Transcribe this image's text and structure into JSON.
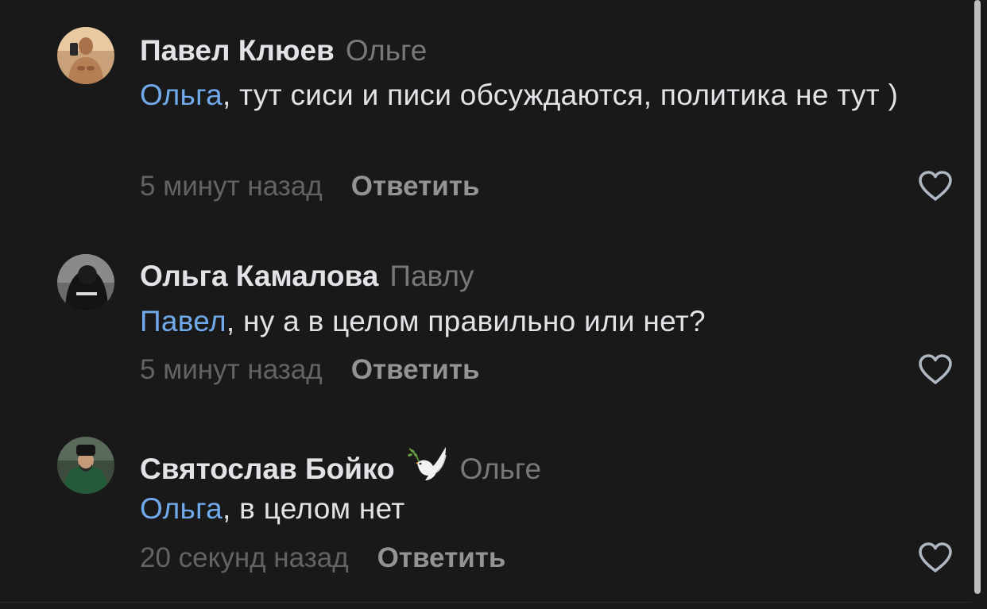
{
  "comments": [
    {
      "author": "Павел Клюев",
      "reply_to": "Ольге",
      "mention": "Ольга",
      "text": ", тут сиси и писи обсуждаются, политика не тут )",
      "time": "5 минут назад",
      "reply_label": "Ответить",
      "avatar": "shirtless-man-photo",
      "like_icon": "heart-outline"
    },
    {
      "author": "Ольга Камалова",
      "reply_to": "Павлу",
      "mention": "Павел",
      "text": ", ну а в целом правильно или нет?",
      "time": "5 минут назад",
      "reply_label": "Ответить",
      "avatar": "person-in-black-hoodie-photo",
      "like_icon": "heart-outline"
    },
    {
      "author": "Святослав Бойко",
      "author_emoji": "dove-with-olive-branch",
      "reply_to": "Ольге",
      "mention": "Ольга",
      "text": ", в целом нет",
      "time": "20 секунд назад",
      "reply_label": "Ответить",
      "avatar": "man-in-papakha-photo",
      "like_icon": "heart-outline"
    }
  ],
  "colors": {
    "background": "#19191a",
    "author": "#e1e3e6",
    "secondary": "#76787a",
    "mention": "#71aaeb",
    "reply_button": "#939393",
    "icon": "#aeb7c2"
  }
}
